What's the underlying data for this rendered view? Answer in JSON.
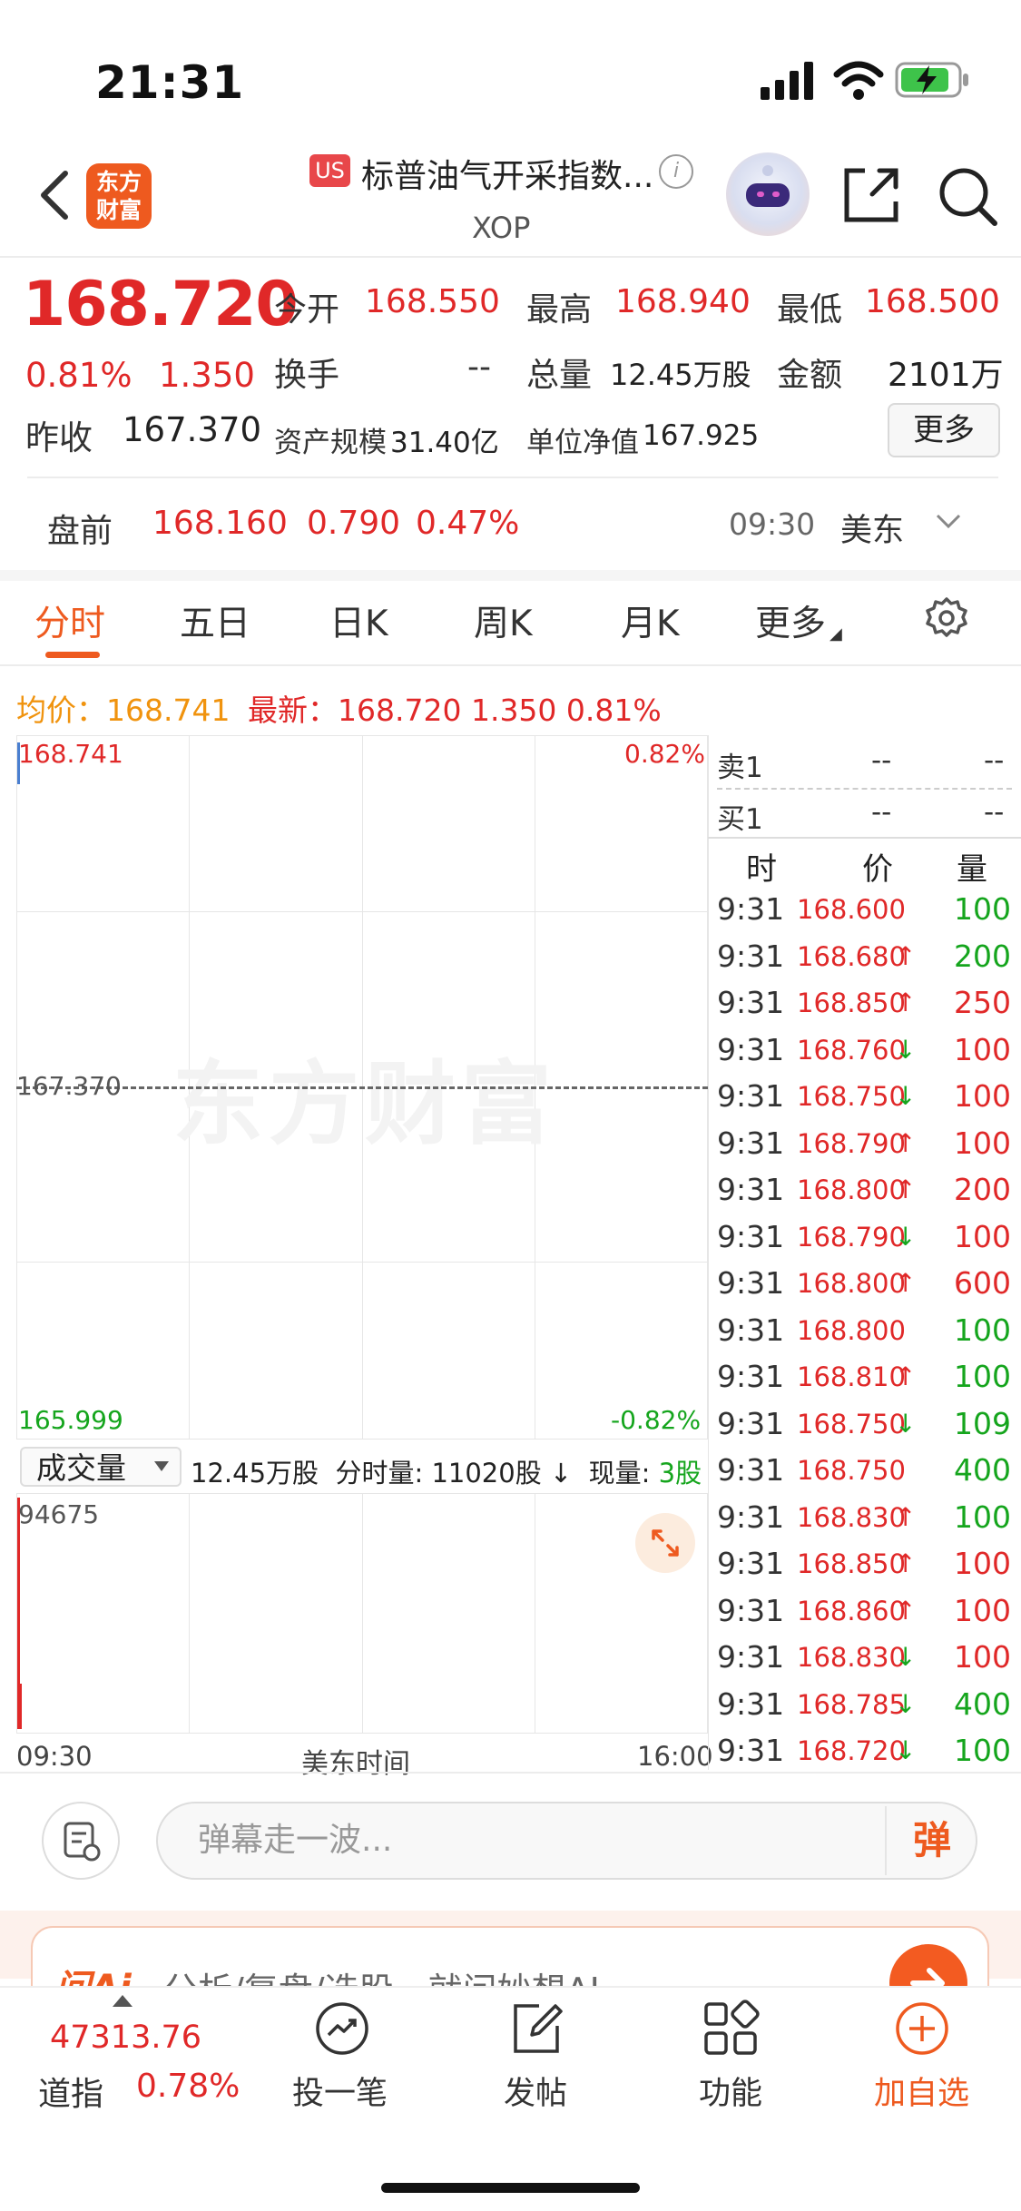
{
  "status_bar": {
    "time": "21:31"
  },
  "header": {
    "brand_logo": "东方\n财富",
    "market_badge": "US",
    "name": "标普油气开采指数...",
    "code": "XOP"
  },
  "quote": {
    "price": "168.720",
    "change_pct": "0.81%",
    "change_amt": "1.350",
    "prev_close_label": "昨收",
    "prev_close": "167.370",
    "open_label": "今开",
    "open": "168.550",
    "high_label": "最高",
    "high": "168.940",
    "low_label": "最低",
    "low": "168.500",
    "turnover_label": "换手",
    "turnover": "--",
    "volume_label": "总量",
    "volume": "12.45万股",
    "amount_label": "金额",
    "amount": "2101万",
    "asset_label": "资产规模",
    "asset": "31.40亿",
    "nav_label": "单位净值",
    "nav": "167.925",
    "more_label": "更多"
  },
  "premarket": {
    "label": "盘前",
    "price": "168.160",
    "change": "0.790",
    "pct": "0.47%",
    "time": "09:30",
    "market": "美东"
  },
  "tabs": [
    "分时",
    "五日",
    "日K",
    "周K",
    "月K",
    "更多"
  ],
  "legend": {
    "avg": "均价：168.741",
    "latest": "最新：168.720  1.350  0.81%"
  },
  "chart": {
    "watermark": "东方财富",
    "y_top": "168.741",
    "y_top_pct": "0.82%",
    "y_mid": "167.370",
    "y_bottom": "165.999",
    "y_bottom_pct": "-0.82%"
  },
  "volume": {
    "dropdown_label": "成交量",
    "info": "12.45万股  分时量: 11020股 ↓  现量: ",
    "info_now": "3股",
    "max": "94675",
    "time_start": "09:30",
    "time_mid": "美东时间",
    "time_end": "16:00"
  },
  "orderbook": {
    "sell_label": "卖1",
    "sell_price": "--",
    "sell_vol": "--",
    "buy_label": "买1",
    "buy_price": "--",
    "buy_vol": "--",
    "headers": [
      "时",
      "价",
      "量"
    ]
  },
  "trades": [
    {
      "t": "9:31",
      "p": "168.600",
      "a": "",
      "v": "100",
      "vc": "green"
    },
    {
      "t": "9:31",
      "p": "168.680",
      "a": "↑",
      "v": "200",
      "vc": "green"
    },
    {
      "t": "9:31",
      "p": "168.850",
      "a": "↑",
      "v": "250",
      "vc": "red"
    },
    {
      "t": "9:31",
      "p": "168.760",
      "a": "↓",
      "v": "100",
      "vc": "red"
    },
    {
      "t": "9:31",
      "p": "168.750",
      "a": "↓",
      "v": "100",
      "vc": "red"
    },
    {
      "t": "9:31",
      "p": "168.790",
      "a": "↑",
      "v": "100",
      "vc": "red"
    },
    {
      "t": "9:31",
      "p": "168.800",
      "a": "↑",
      "v": "200",
      "vc": "red"
    },
    {
      "t": "9:31",
      "p": "168.790",
      "a": "↓",
      "v": "100",
      "vc": "red"
    },
    {
      "t": "9:31",
      "p": "168.800",
      "a": "↑",
      "v": "600",
      "vc": "red"
    },
    {
      "t": "9:31",
      "p": "168.800",
      "a": "",
      "v": "100",
      "vc": "green"
    },
    {
      "t": "9:31",
      "p": "168.810",
      "a": "↑",
      "v": "100",
      "vc": "green"
    },
    {
      "t": "9:31",
      "p": "168.750",
      "a": "↓",
      "v": "109",
      "vc": "green"
    },
    {
      "t": "9:31",
      "p": "168.750",
      "a": "",
      "v": "400",
      "vc": "green"
    },
    {
      "t": "9:31",
      "p": "168.830",
      "a": "↑",
      "v": "100",
      "vc": "green"
    },
    {
      "t": "9:31",
      "p": "168.850",
      "a": "↑",
      "v": "100",
      "vc": "red"
    },
    {
      "t": "9:31",
      "p": "168.860",
      "a": "↑",
      "v": "100",
      "vc": "red"
    },
    {
      "t": "9:31",
      "p": "168.830",
      "a": "↓",
      "v": "100",
      "vc": "red"
    },
    {
      "t": "9:31",
      "p": "168.785",
      "a": "↓",
      "v": "400",
      "vc": "green"
    },
    {
      "t": "9:31",
      "p": "168.720",
      "a": "↓",
      "v": "100",
      "vc": "green"
    }
  ],
  "chat": {
    "placeholder": "弹幕走一波...",
    "danmu_label": "弹"
  },
  "ai_banner": {
    "logo": "问Ai",
    "text": "分析/复盘/选股，就问妙想AI"
  },
  "bottom_nav": {
    "index_value": "47313.76",
    "index_name": "道指",
    "index_pct": "0.78%",
    "items": [
      {
        "label": "投一笔",
        "icon": "chart-trend-icon"
      },
      {
        "label": "发帖",
        "icon": "edit-icon"
      },
      {
        "label": "功能",
        "icon": "grid-icon"
      },
      {
        "label": "加自选",
        "icon": "add-circle-icon"
      }
    ]
  },
  "colors": {
    "up": "#e02828",
    "down": "#15a51d",
    "brand": "#ee5a1f",
    "avg": "#f0930e"
  }
}
